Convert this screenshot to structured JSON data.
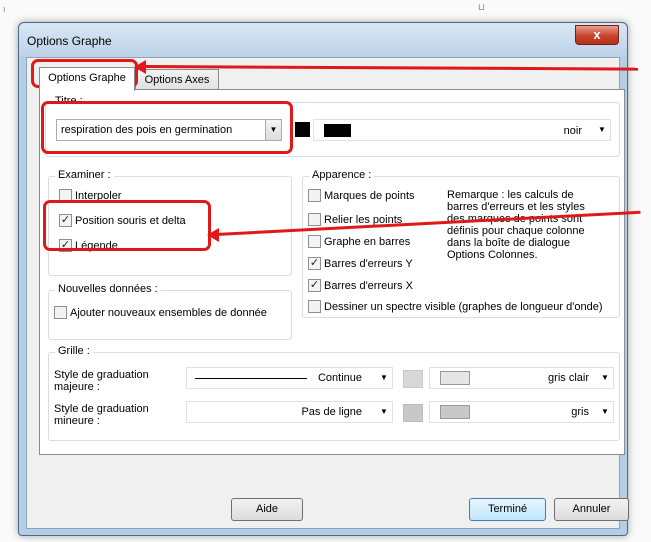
{
  "window": {
    "title": "Options Graphe",
    "close_glyph": "x"
  },
  "tabs": [
    {
      "label": "Options Graphe",
      "active": true
    },
    {
      "label": "Options Axes",
      "active": false
    }
  ],
  "titre": {
    "group_label": "Titre :",
    "value": "respiration des pois en germination",
    "color_value": "noir"
  },
  "examiner": {
    "group_label": "Examiner :",
    "items": [
      {
        "label": "Interpoler",
        "checked": false
      },
      {
        "label": "Position souris et delta",
        "checked": true
      },
      {
        "label": "Légende",
        "checked": true
      }
    ]
  },
  "nouvelles": {
    "group_label": "Nouvelles données :",
    "items": [
      {
        "label": "Ajouter nouveaux ensembles de donnée",
        "checked": false
      }
    ]
  },
  "apparence": {
    "group_label": "Apparence :",
    "items": [
      {
        "label": "Marques de points",
        "checked": false
      },
      {
        "label": "Relier les points",
        "checked": false
      },
      {
        "label": "Graphe en barres",
        "checked": false
      },
      {
        "label": "Barres d'erreurs Y",
        "checked": true
      },
      {
        "label": "Barres d'erreurs X",
        "checked": true
      },
      {
        "label": "Dessiner un spectre visible (graphes de longueur d'onde)",
        "checked": false
      }
    ],
    "remark_lines": [
      "Remarque : les calculs de",
      "barres d'erreurs et les styles",
      "des marques de points sont",
      "définis pour chaque colonne",
      "dans la boîte de dialogue",
      "Options Colonnes."
    ]
  },
  "grille": {
    "group_label": "Grille :",
    "rows": [
      {
        "label_line1": "Style de graduation",
        "label_line2": "majeure :",
        "style_value": "Continue",
        "color_value": "gris clair",
        "swatch_color": "#e6e6e6"
      },
      {
        "label_line1": "Style de graduation",
        "label_line2": "mineure :",
        "style_value": "Pas de ligne",
        "color_value": "gris",
        "swatch_color": "#c8c8c8"
      }
    ]
  },
  "buttons": {
    "aide": "Aide",
    "termine": "Terminé",
    "annuler": "Annuler"
  },
  "colors": {
    "annotation_red": "#e01818",
    "title_color_swatch": "#000000",
    "default_button_blue": "#3c7fb1"
  },
  "icons": [
    "close-icon",
    "dropdown-arrow-icon",
    "checkbox-icon",
    "annotation-arrow-icon"
  ]
}
